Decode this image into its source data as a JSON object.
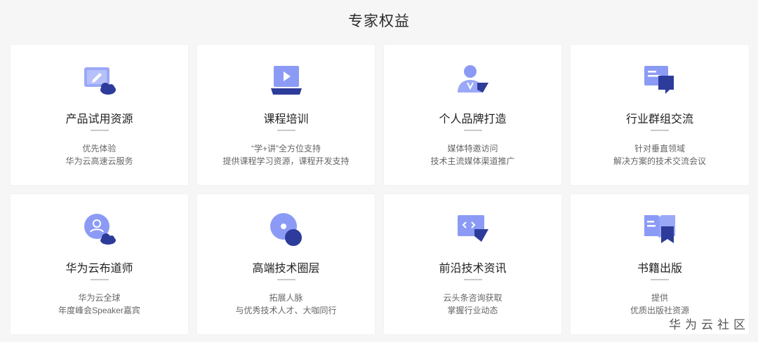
{
  "page_title": "专家权益",
  "watermark": "华为云社区",
  "colors": {
    "icon_light": "#8b9bf5",
    "icon_dark": "#2d3b9a",
    "accent": "#5a6fe0"
  },
  "cards": [
    {
      "icon": "laptop-edit-cloud-icon",
      "title": "产品试用资源",
      "lines": [
        "优先体验",
        "华为云高速云服务"
      ]
    },
    {
      "icon": "video-monitor-icon",
      "title": "课程培训",
      "lines": [
        "“学+讲”全方位支持",
        "提供课程学习资源，课程开发支持"
      ]
    },
    {
      "icon": "person-badge-icon",
      "title": "个人品牌打造",
      "lines": [
        "媒体特邀访问",
        "技术主流媒体渠道推广"
      ]
    },
    {
      "icon": "chat-bubbles-icon",
      "title": "行业群组交流",
      "lines": [
        "针对垂直领域",
        "解决方案的技术交流会议"
      ]
    },
    {
      "icon": "user-circle-cloud-icon",
      "title": "华为云布道师",
      "lines": [
        "华为云全球",
        "年度峰会Speaker嘉宾"
      ]
    },
    {
      "icon": "disc-circle-icon",
      "title": "高端技术圈层",
      "lines": [
        "拓展人脉",
        "与优秀技术人才、大咖同行"
      ]
    },
    {
      "icon": "code-window-icon",
      "title": "前沿技术资讯",
      "lines": [
        "云头条咨询获取",
        "掌握行业动态"
      ]
    },
    {
      "icon": "book-bookmark-icon",
      "title": "书籍出版",
      "lines": [
        "提供",
        "优质出版社资源"
      ]
    }
  ]
}
